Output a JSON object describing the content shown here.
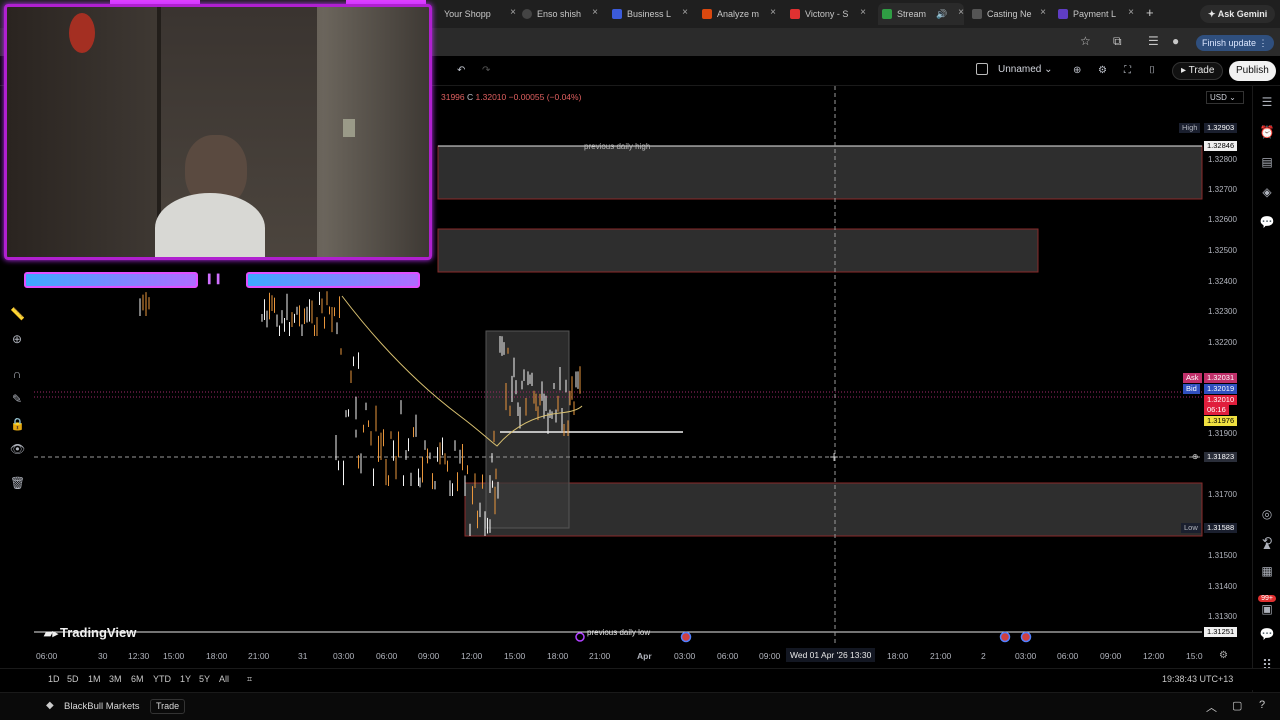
{
  "browser": {
    "tabs": [
      {
        "label": "Your Shopp",
        "color": "#2b9c4a"
      },
      {
        "label": "Enso shish",
        "color": "#444444"
      },
      {
        "label": "Business L",
        "color": "#3b5bdb"
      },
      {
        "label": "Analyze m",
        "color": "#d9480f"
      },
      {
        "label": "Victony - S",
        "color": "#e03131"
      },
      {
        "label": "Stream",
        "color": "#2f9e44"
      },
      {
        "label": "Casting Ne",
        "color": "#555555"
      },
      {
        "label": "Payment L",
        "color": "#5f3dc4"
      }
    ],
    "new_tab": "+",
    "ask_gemini": "Ask Gemini",
    "finish_update": "Finish update"
  },
  "toolbar": {
    "layout_name": "Unnamed",
    "trade": "Trade",
    "publish": "Publish"
  },
  "ohlc": {
    "prefix": "31996",
    "close_label": "C",
    "close": "1.32010",
    "change": "−0.00055 (−0.04%)"
  },
  "currency": "USD",
  "annotations": {
    "prev_high": "previous daily high",
    "prev_low": "previous daily low"
  },
  "price_axis": {
    "ticks": [
      "1.32800",
      "1.32700",
      "1.32600",
      "1.32500",
      "1.32400",
      "1.32300",
      "1.32200",
      "1.31900",
      "1.31700",
      "1.31500",
      "1.31400",
      "1.31300"
    ],
    "high_label": "High",
    "high_value": "1.32903",
    "prev_high_value": "1.32846",
    "ask_label": "Ask",
    "ask_value": "1.32031",
    "bid_label": "Bid",
    "bid_value": "1.32019",
    "last_value": "1.32010",
    "countdown": "06:16",
    "ma_value": "1.31976",
    "crosshair_value": "1.31823",
    "low_label": "Low",
    "low_value": "1.31588",
    "prev_low_value": "1.31251"
  },
  "time_axis": {
    "ticks": [
      "06:00",
      "30",
      "12:30",
      "15:00",
      "18:00",
      "21:00",
      "31",
      "03:00",
      "06:00",
      "09:00",
      "12:00",
      "15:00",
      "18:00",
      "21:00",
      "Apr",
      "03:00",
      "06:00",
      "09:00",
      "18:00",
      "21:00",
      "2",
      "03:00",
      "06:00",
      "09:00",
      "12:00",
      "15:0"
    ],
    "crosshair": "Wed 01 Apr '26  13:30"
  },
  "logo": "TradingView",
  "ranges": [
    "1D",
    "5D",
    "1M",
    "3M",
    "6M",
    "YTD",
    "1Y",
    "5Y",
    "All"
  ],
  "clock": "19:38:43 UTC+13",
  "broker": {
    "name": "BlackBull Markets",
    "trade": "Trade"
  },
  "notifications": "99+",
  "chart_data": {
    "type": "candlestick",
    "ylim": [
      1.3125,
      1.33
    ],
    "zones": [
      {
        "from": 1.3268,
        "to": 1.32846
      },
      {
        "from": 1.3243,
        "to": 1.3257
      },
      {
        "from": 1.3156,
        "to": 1.3173
      }
    ],
    "lines": [
      {
        "label": "previous daily high",
        "price": 1.32846
      },
      {
        "label": "previous daily low",
        "price": 1.31251
      }
    ],
    "crosshair_price": 1.31823,
    "ma_value": 1.31976
  }
}
